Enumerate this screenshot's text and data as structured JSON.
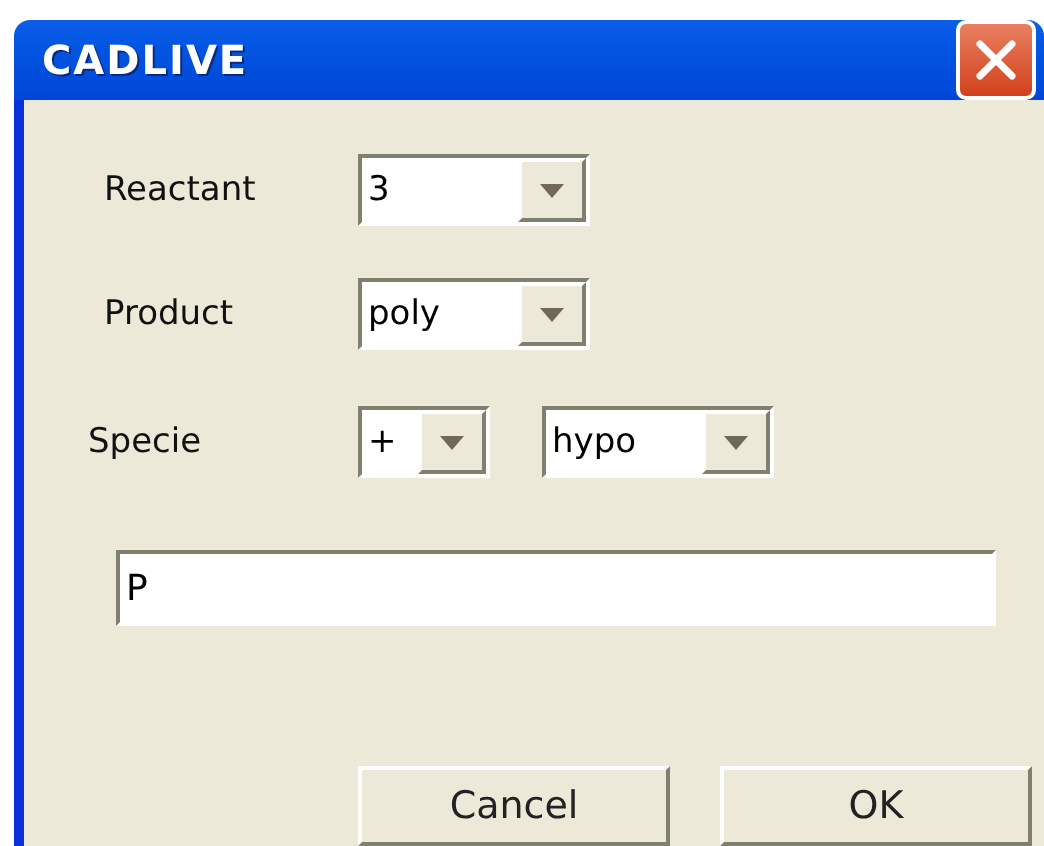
{
  "window": {
    "title": "CADLIVE"
  },
  "rows": [
    {
      "label": "Reactant",
      "combos": [
        {
          "value": "3"
        }
      ]
    },
    {
      "label": "Product",
      "combos": [
        {
          "value": "poly"
        }
      ]
    },
    {
      "label": "Specie",
      "combos": [
        {
          "value": "+"
        },
        {
          "value": "hypo"
        }
      ]
    }
  ],
  "text_field": {
    "value": "P"
  },
  "buttons": [
    "Cancel",
    "OK"
  ]
}
